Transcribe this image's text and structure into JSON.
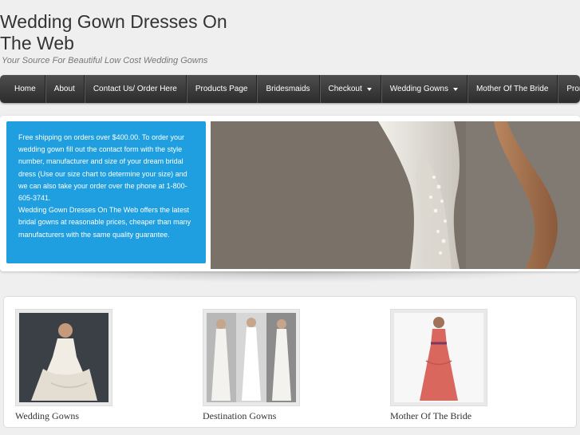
{
  "header": {
    "title": "Wedding Gown Dresses On The Web",
    "tagline": "Your Source For Beautiful Low Cost Wedding Gowns"
  },
  "nav": {
    "items": [
      {
        "label": "Home",
        "has_dropdown": false
      },
      {
        "label": "About",
        "has_dropdown": false
      },
      {
        "label": "Contact Us/ Order Here",
        "has_dropdown": false
      },
      {
        "label": "Products Page",
        "has_dropdown": false
      },
      {
        "label": "Bridesmaids",
        "has_dropdown": false
      },
      {
        "label": "Checkout",
        "has_dropdown": true
      },
      {
        "label": "Wedding Gowns",
        "has_dropdown": true
      },
      {
        "label": "Mother Of The Bride",
        "has_dropdown": false
      },
      {
        "label": "Prom",
        "has_dropdown": true
      }
    ]
  },
  "promo": {
    "paragraph1": "Free shipping on orders over $400.00. To order your wedding gown fill out the contact form with the style number, manufacturer and size of your dream bridal dress (Use our size chart to determine your size) and we can also take your order over the phone at 1-800-605-3741.",
    "paragraph2": "Wedding Gown Dresses On The Web offers the latest bridal gowns at reasonable prices, cheaper than many manufacturers with the same quality guarantee."
  },
  "categories": [
    {
      "label": "Wedding Gowns"
    },
    {
      "label": "Destination Gowns"
    },
    {
      "label": "Mother Of The Bride"
    }
  ],
  "colors": {
    "accent": "#1f9ee0",
    "nav_bg": "#3a3a3a"
  }
}
